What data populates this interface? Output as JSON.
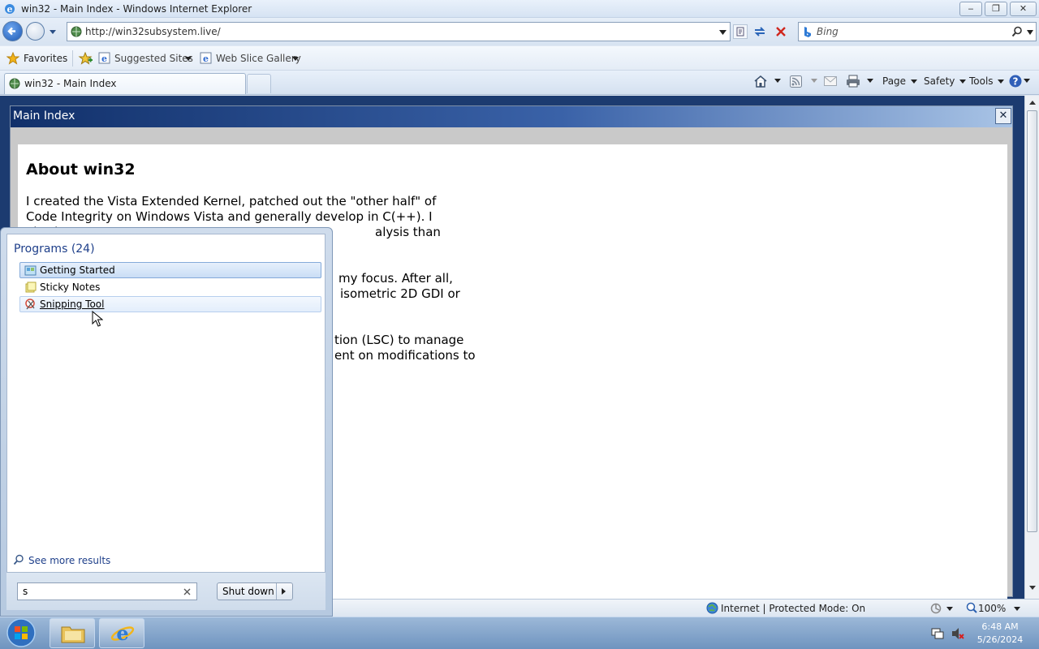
{
  "window": {
    "title": "win32 - Main Index - Windows Internet Explorer",
    "controls": {
      "minimize": "‒",
      "restore": "❐",
      "close": "✕"
    }
  },
  "address_bar": {
    "url": "http://win32subsystem.live/",
    "search_placeholder": "Bing"
  },
  "favorites_bar": {
    "favorites_label": "Favorites",
    "suggested_sites_label": "Suggested Sites",
    "web_slice_label": "Web Slice Gallery"
  },
  "tabs": [
    {
      "label": "win32 - Main Index"
    }
  ],
  "command_bar": {
    "page_label": "Page",
    "safety_label": "Safety",
    "tools_label": "Tools"
  },
  "content": {
    "panel_title": "Main Index",
    "panel_close": "✕",
    "heading": "About win32",
    "paragraphs": [
      "I created the Vista Extended Kernel, patched out the \"other half\" of Code Integrity on Windows Vista and generally develop in C(++). I also have",
      "alysis than",
      "my focus. After all,",
      "isometric 2D GDI or",
      "tion (LSC) to manage",
      "ent on modifications to"
    ]
  },
  "status_bar": {
    "zone": "Internet | Protected Mode: On",
    "zoom": "100%"
  },
  "start_menu": {
    "programs_header": "Programs (24)",
    "programs": [
      {
        "label": "Getting Started",
        "state": "selected"
      },
      {
        "label": "Sticky Notes",
        "state": "normal"
      },
      {
        "label": "Snipping Tool",
        "state": "hover"
      }
    ],
    "see_more": "See more results",
    "search_value": "s",
    "shutdown_label": "Shut down"
  },
  "taskbar": {
    "time": "6:48 AM",
    "date": "5/26/2024"
  },
  "colors": {
    "accent": "#1e3f8a",
    "panel_title_dark": "#11306a",
    "panel_title_light": "#a9c4e6"
  }
}
